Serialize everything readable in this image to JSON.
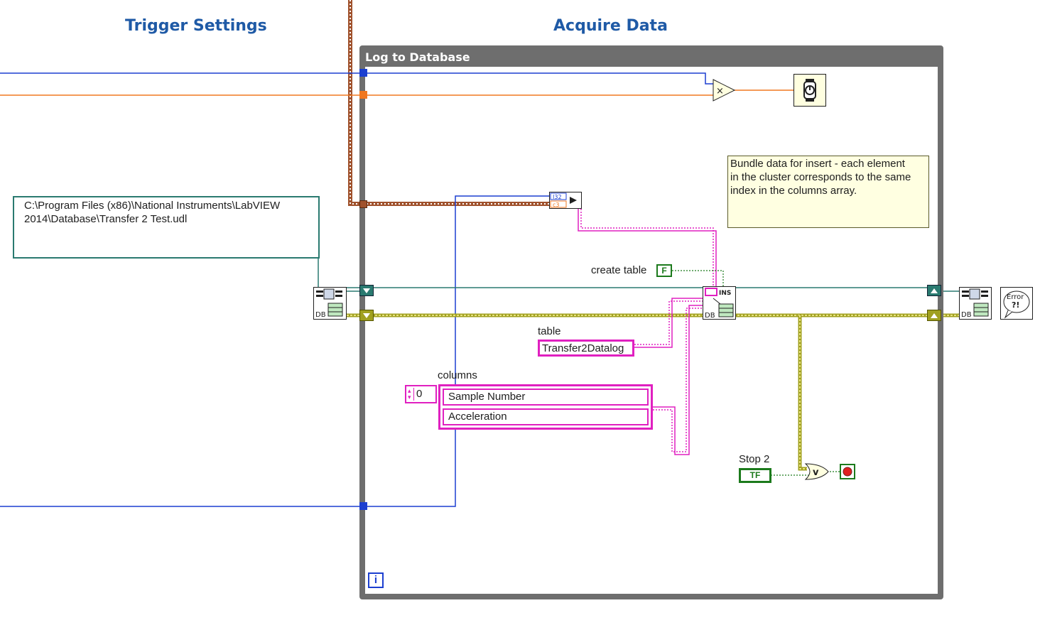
{
  "sections": {
    "trigger_settings": "Trigger Settings",
    "acquire_data": "Acquire Data"
  },
  "loop": {
    "title": "Log to Database",
    "iteration_terminal": "i"
  },
  "path_constant": {
    "line1": "C:\\Program Files (x86)\\National Instruments\\LabVIEW",
    "line2": "2014\\Database\\Transfer 2 Test.udl"
  },
  "comment": {
    "line1": "Bundle data for insert - each element",
    "line2": "in the cluster corresponds to the same",
    "line3": "index in the columns array."
  },
  "create_table": {
    "label": "create table",
    "value": "F"
  },
  "table": {
    "label": "table",
    "value": "Transfer2Datalog"
  },
  "columns": {
    "label": "columns",
    "index": "0",
    "items": [
      "Sample Number",
      "Acceleration"
    ]
  },
  "stop_control": {
    "label": "Stop 2",
    "value": "TF"
  },
  "nodes": {
    "db_label": "DB",
    "insert_label": "INS",
    "bundle_top": "I32",
    "bundle_bottom": "c3",
    "error_line1": "Error",
    "error_line2": "?!",
    "multiply": "×",
    "or": "v"
  },
  "icons": {
    "open_connection": "db-open-connection-icon",
    "insert_data": "db-insert-data-icon",
    "close_connection": "db-close-connection-icon",
    "error_handler": "simple-error-handler-icon",
    "wait": "wait-ms-icon",
    "stop": "stop-terminal-icon"
  },
  "colors": {
    "numeric_wire": "#1c3fd0",
    "float_wire": "#f07820",
    "string_wire": "#e020c0",
    "error_wire": "#a0a020",
    "refnum_wire": "#2a7a70",
    "cluster_wire": "#a0522d",
    "boolean_wire": "#1c7a1c",
    "loop_frame": "#6e6e6e",
    "section_title": "#1f5aa6"
  }
}
